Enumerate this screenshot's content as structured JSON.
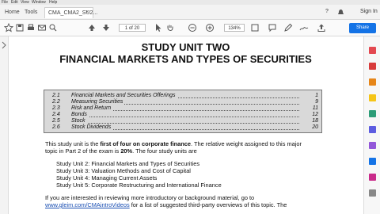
{
  "menubar": {
    "items": [
      "File",
      "Edit",
      "View",
      "Window",
      "Help"
    ]
  },
  "tabs": [
    {
      "label": "Home"
    },
    {
      "label": "Tools"
    },
    {
      "label": "CMA_CMA2_SU2..."
    }
  ],
  "top_right": {
    "help": "?",
    "signin": "Sign In"
  },
  "toolbar": {
    "page": "1 of 20",
    "zoom": "134%",
    "share": "Share"
  },
  "document": {
    "title_line1": "STUDY UNIT TWO",
    "title_line2": "FINANCIAL MARKETS AND TYPES OF SECURITIES",
    "toc": [
      {
        "num": "2.1",
        "title": "Financial Markets and Securities Offerings",
        "page": "1"
      },
      {
        "num": "2.2",
        "title": "Measuring Securities",
        "page": "9"
      },
      {
        "num": "2.3",
        "title": "Risk and Return",
        "page": "11"
      },
      {
        "num": "2.4",
        "title": "Bonds",
        "page": "12"
      },
      {
        "num": "2.5",
        "title": "Stock",
        "page": "18"
      },
      {
        "num": "2.6",
        "title": "Stock Dividends",
        "page": "20"
      }
    ],
    "intro": {
      "p1a": "This study unit is the ",
      "p1b": "first of four on corporate finance",
      "p1c": ". The relative weight assigned to this major",
      "p2a": "topic in Part 2 of the exam is ",
      "p2b": "20%",
      "p2c": ". The four study units are"
    },
    "units": [
      "Study Unit 2: Financial Markets and Types of Securities",
      "Study Unit 3: Valuation Methods and Cost of Capital",
      "Study Unit 4: Managing Current Assets",
      "Study Unit 5: Corporate Restructuring and International Finance"
    ],
    "closing_line1": "If you are interested in reviewing more introductory or background material, go to",
    "closing_line2_link": "www.gleim.com/CMAintroVideos",
    "closing_line2_rest": " for a list of suggested third-party overviews of this topic. The"
  }
}
